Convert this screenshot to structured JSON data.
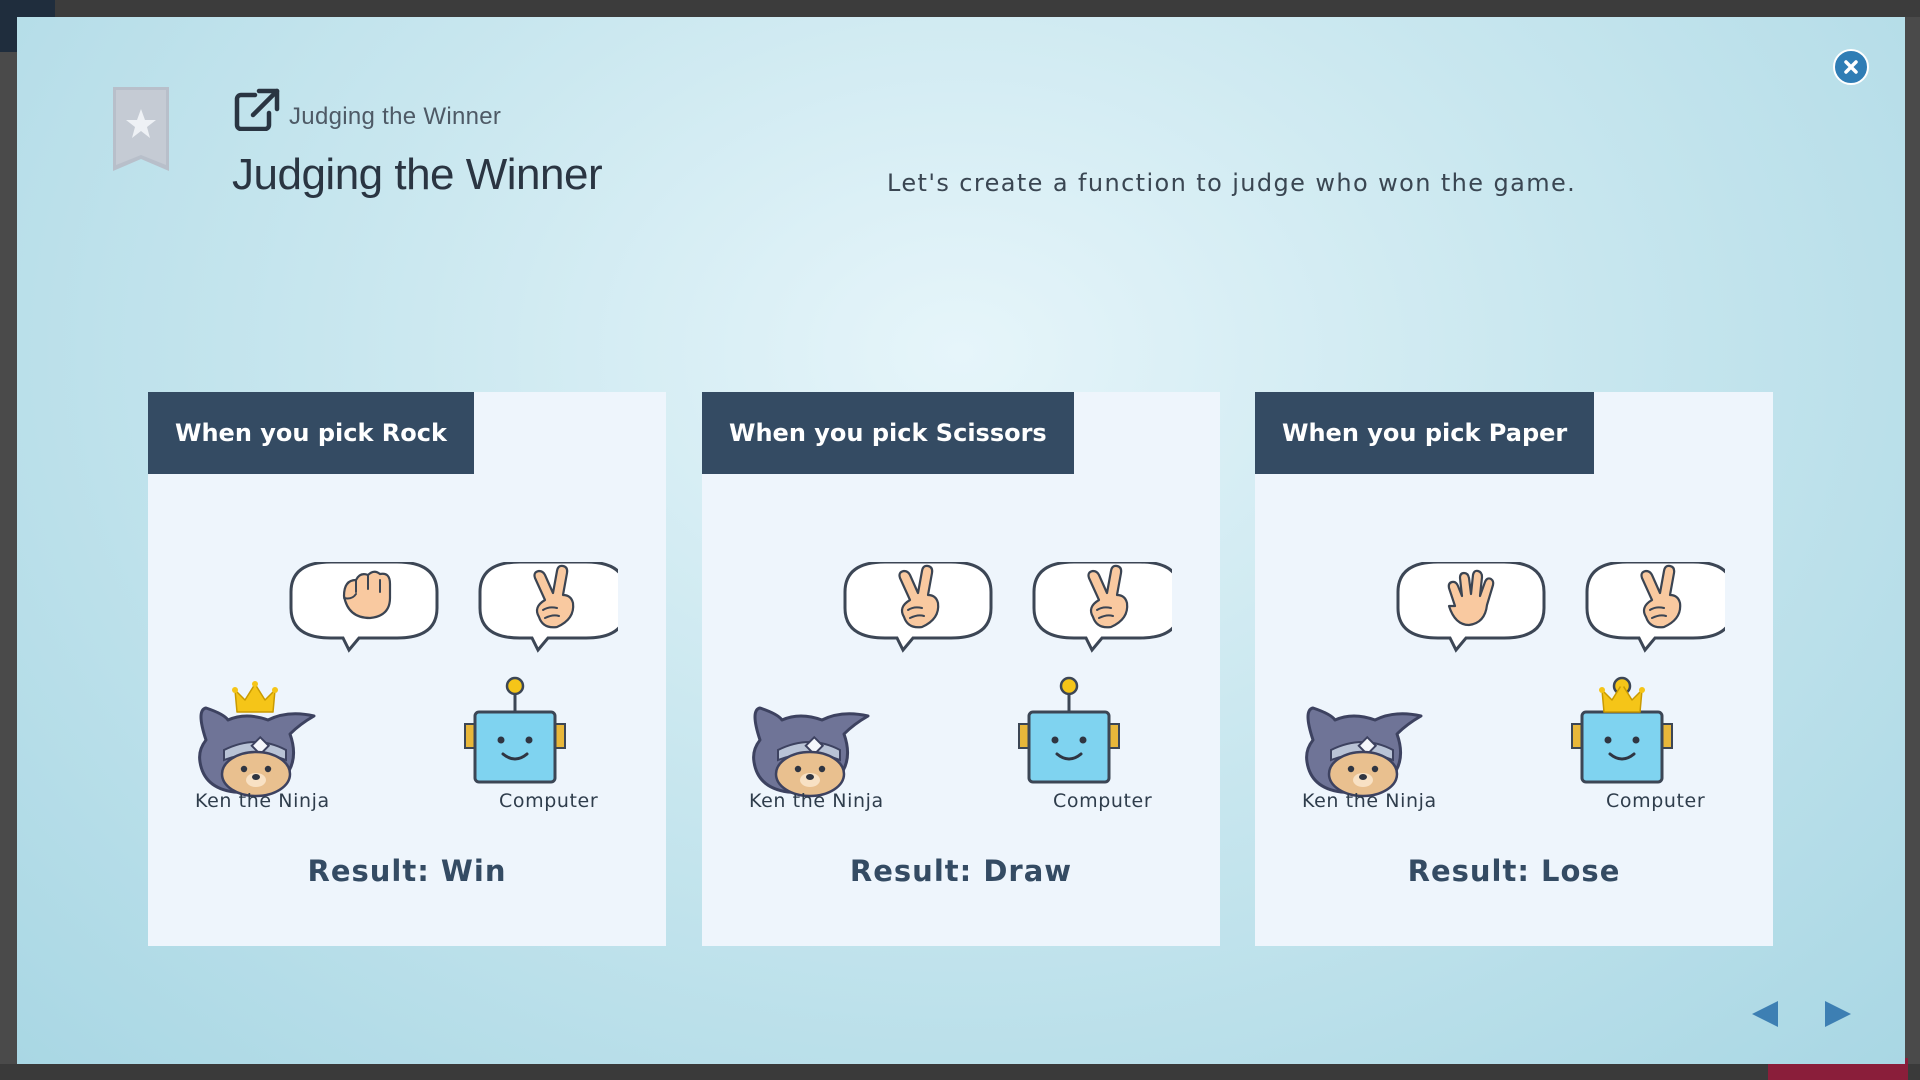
{
  "lesson": {
    "breadcrumb": "Judging the Winner",
    "title": "Judging the Winner",
    "description": "Let's create a function to judge who won the game."
  },
  "cards": [
    {
      "header": "When you pick Rock",
      "player_hand": "rock",
      "computer_hand": "scissors",
      "winner": "player",
      "player_label": "Ken the Ninja",
      "computer_label": "Computer",
      "result_prefix": "Result:",
      "result_value": "Win"
    },
    {
      "header": "When you pick Scissors",
      "player_hand": "scissors",
      "computer_hand": "scissors",
      "winner": "none",
      "player_label": "Ken the Ninja",
      "computer_label": "Computer",
      "result_prefix": "Result:",
      "result_value": "Draw"
    },
    {
      "header": "When you pick Paper",
      "player_hand": "paper",
      "computer_hand": "scissors",
      "winner": "computer",
      "player_label": "Ken the Ninja",
      "computer_label": "Computer",
      "result_prefix": "Result:",
      "result_value": "Lose"
    }
  ],
  "icons": {
    "bookmark": "bookmark-star-icon",
    "external": "external-link-icon",
    "close": "close-icon",
    "prev": "prev-arrow-icon",
    "next": "next-arrow-icon"
  },
  "colors": {
    "card_header": "#344b63",
    "accent_blue": "#2f7db5",
    "crown": "#f5c518",
    "robot": "#7fd3f0"
  }
}
